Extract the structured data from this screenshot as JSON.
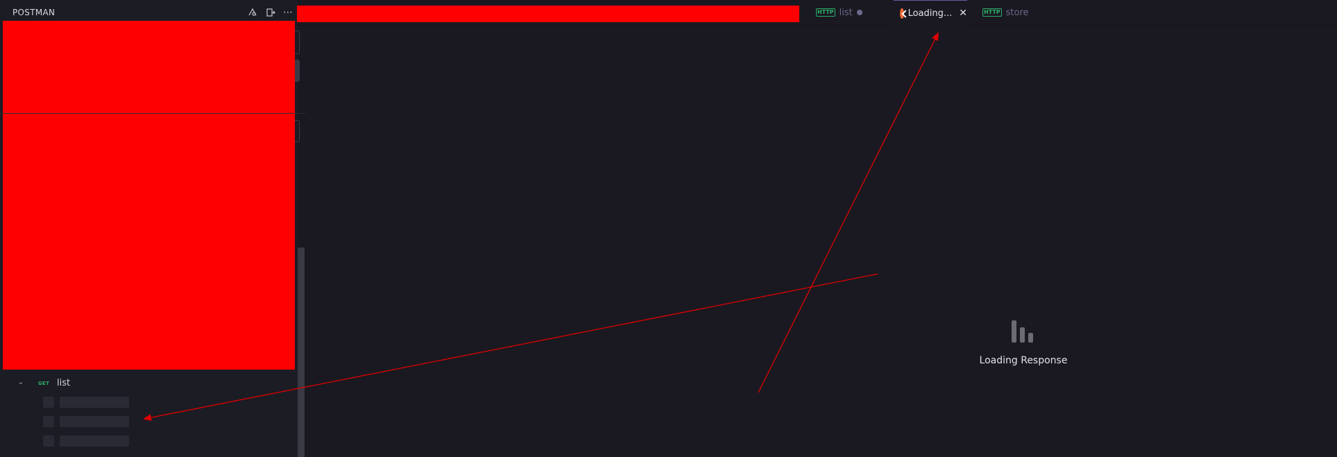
{
  "sidebar": {
    "title": "POSTMAN",
    "header_icons": [
      "cookie-icon",
      "import-icon",
      "more-icon"
    ],
    "tree": {
      "method": "GET",
      "request_name": "list"
    }
  },
  "tabs": [
    {
      "label": "list",
      "type": "http",
      "unsaved": true
    },
    {
      "label": "Loading...",
      "type": "postman",
      "active": true,
      "close": "✕"
    },
    {
      "label": "store",
      "type": "http"
    }
  ],
  "http_badge": "HTTP",
  "response": {
    "status_text": "Loading Response"
  },
  "colors": {
    "redaction": "#ff0000",
    "annotation": "#e00000",
    "accent_get": "#2fae6a",
    "postman_orange": "#ef6a35"
  }
}
